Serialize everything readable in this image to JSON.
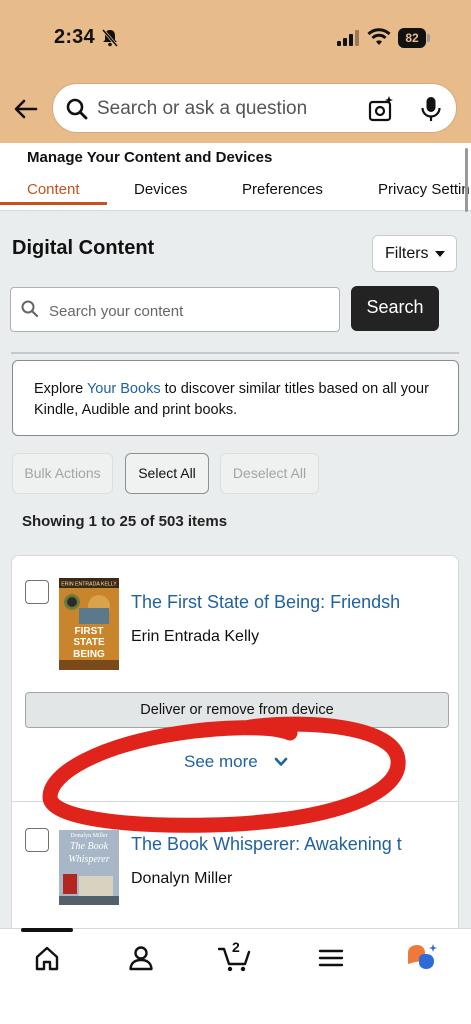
{
  "status_bar": {
    "time": "2:34",
    "battery": "82"
  },
  "search": {
    "placeholder": "Search or ask a question"
  },
  "page": {
    "section_title": "Manage Your Content and Devices",
    "tabs": [
      {
        "label": "Content",
        "active": true
      },
      {
        "label": "Devices",
        "active": false
      },
      {
        "label": "Preferences",
        "active": false
      },
      {
        "label": "Privacy Settin",
        "active": false
      }
    ]
  },
  "content": {
    "heading": "Digital Content",
    "filters_label": "Filters",
    "search_placeholder": "Search your content",
    "search_button": "Search",
    "info": {
      "prefix": "Explore ",
      "link": "Your Books",
      "suffix": " to discover similar titles based on all your Kindle, Audible and print books."
    },
    "actions": {
      "bulk": "Bulk Actions",
      "select_all": "Select All",
      "deselect_all": "Deselect All"
    },
    "showing": "Showing 1 to 25 of 503 items",
    "items": [
      {
        "title": "The First State of Being: Friendsh",
        "author": "Erin Entrada Kelly",
        "cover_text": [
          "ERIN ENTRADA KELLY",
          "FIRST",
          "STATE",
          "BEING"
        ],
        "deliver_label": "Deliver or remove from device",
        "see_more": "See more"
      },
      {
        "title": "The Book Whisperer: Awakening t",
        "author": "Donalyn Miller",
        "cover_text": [
          "Donalyn Miller",
          "The Book",
          "Whisperer"
        ]
      }
    ]
  },
  "bottom_nav": {
    "cart_count": "2"
  },
  "colors": {
    "header_orange": "#e8bb8b",
    "link_blue": "#2162a1",
    "tab_active": "#c7511f",
    "annotation_red": "#e0241b"
  }
}
